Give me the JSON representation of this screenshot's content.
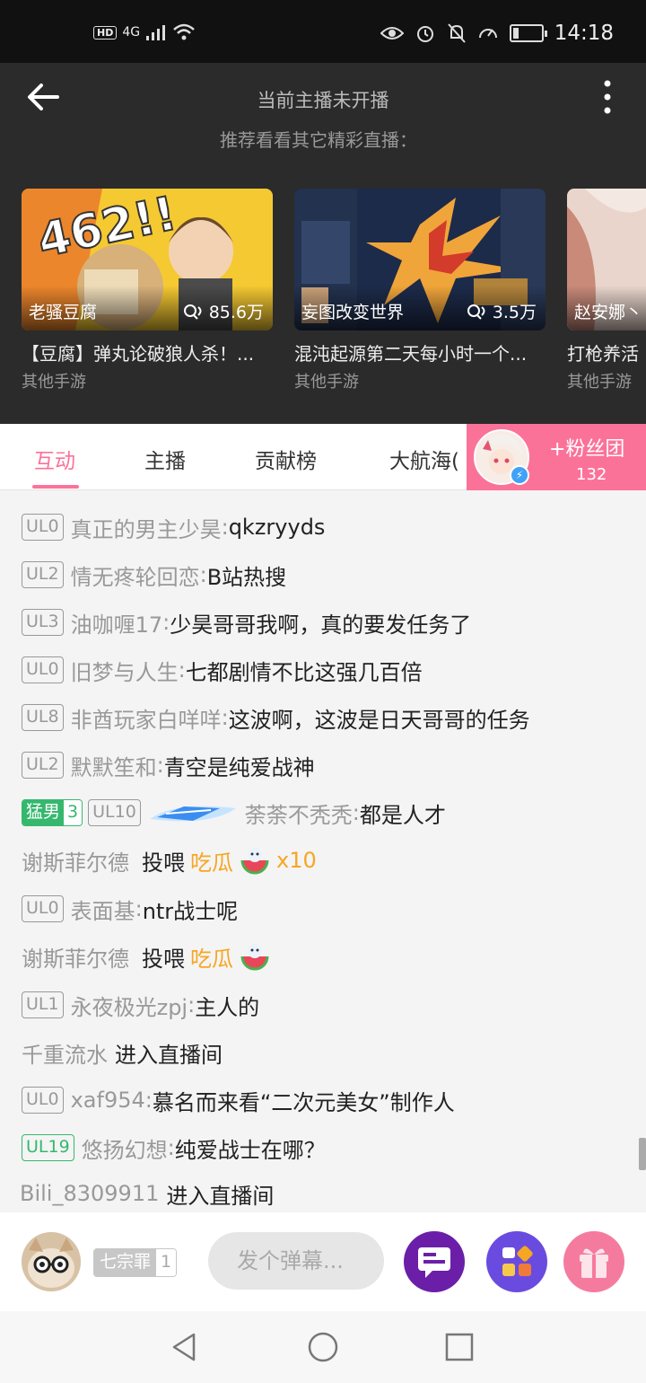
{
  "status_bar": {
    "network_hd": "HD",
    "network_type": "4G",
    "time": "14:18"
  },
  "header": {
    "title": "当前主播未开播",
    "subtitle": "推荐看看其它精彩直播："
  },
  "recommendations": [
    {
      "uploader": "老骚豆腐",
      "views": "85.6万",
      "title": "【豆腐】弹丸论破狼人杀！...",
      "category": "其他手游"
    },
    {
      "uploader": "妄图改变世界",
      "views": "3.5万",
      "title": "混沌起源第二天每小时一个...",
      "category": "其他手游"
    },
    {
      "uploader": "赵安娜丶",
      "views": "",
      "title": "打枪养活",
      "category": "其他手游"
    }
  ],
  "tabs": [
    {
      "label": "互动",
      "active": true
    },
    {
      "label": "主播",
      "active": false
    },
    {
      "label": "贡献榜",
      "active": false
    },
    {
      "label": "大航海(",
      "active": false
    }
  ],
  "fan_club": {
    "label": "+粉丝团",
    "count": "132"
  },
  "chat": [
    {
      "level": "UL0",
      "user": "真正的男主少昊",
      "sep": ": ",
      "message": "qkzryyds"
    },
    {
      "level": "UL2",
      "user": "情无疼轮回恋",
      "sep": ": ",
      "message": "B站热搜"
    },
    {
      "level": "UL3",
      "user": "油咖喱17",
      "sep": ": ",
      "message": "少昊哥哥我啊，真的要发任务了"
    },
    {
      "level": "UL0",
      "user": "旧梦与人生",
      "sep": ": ",
      "message": "七都剧情不比这强几百倍"
    },
    {
      "level": "UL8",
      "user": "非酋玩家白咩咩",
      "sep": ": ",
      "message": "这波啊，这波是日天哥哥的任务"
    },
    {
      "level": "UL2",
      "user": "默默笙和",
      "sep": ": ",
      "message": "青空是纯爱战神"
    },
    {
      "medal_name": "猛男",
      "medal_level": "3",
      "level": "UL10",
      "user": "荼荼不秃秃",
      "sep": ": ",
      "message": "都是人才"
    },
    {
      "user": "谢斯菲尔德",
      "action": "投喂",
      "gift": "吃瓜",
      "gift_count": "x10"
    },
    {
      "level": "UL0",
      "user": "表面基",
      "sep": ": ",
      "message": "ntr战士呢"
    },
    {
      "user": "谢斯菲尔德",
      "action": "投喂",
      "gift": "吃瓜"
    },
    {
      "level": "UL1",
      "user": "永夜极光zpj",
      "sep": ": ",
      "message": "主人的"
    },
    {
      "user": "千重流水",
      "entered": "进入直播间"
    },
    {
      "level": "UL0",
      "user": "xaf954",
      "sep": ": ",
      "message": "慕名而来看“二次元美女”制作人"
    },
    {
      "level": "UL19",
      "user": "悠扬幻想",
      "sep": ": ",
      "message": "纯爱战士在哪？"
    },
    {
      "user": "Bili_8309911",
      "entered": "进入直播间"
    }
  ],
  "input_bar": {
    "medal_name": "七宗罪",
    "medal_level": "1",
    "placeholder": "发个弹幕..."
  },
  "colors": {
    "accent": "#fb7299",
    "medal_green": "#35b86d",
    "gift_orange": "#f6a623"
  }
}
